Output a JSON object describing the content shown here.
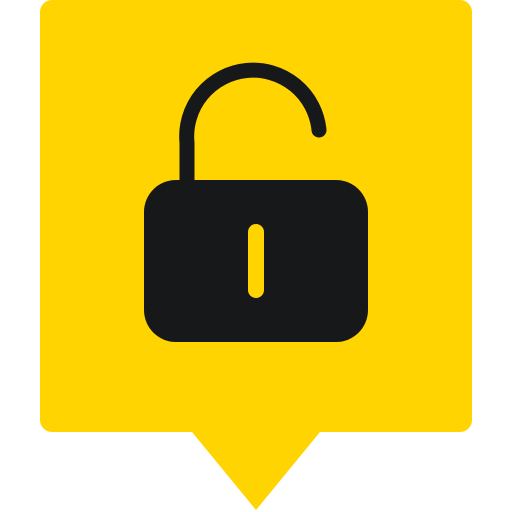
{
  "icon": {
    "name": "unlocked-padlock-map-pin-icon",
    "pin_color": "#FFD400",
    "lock_color": "#16181A",
    "keyhole_color": "#FFD400",
    "state": "unlocked"
  }
}
